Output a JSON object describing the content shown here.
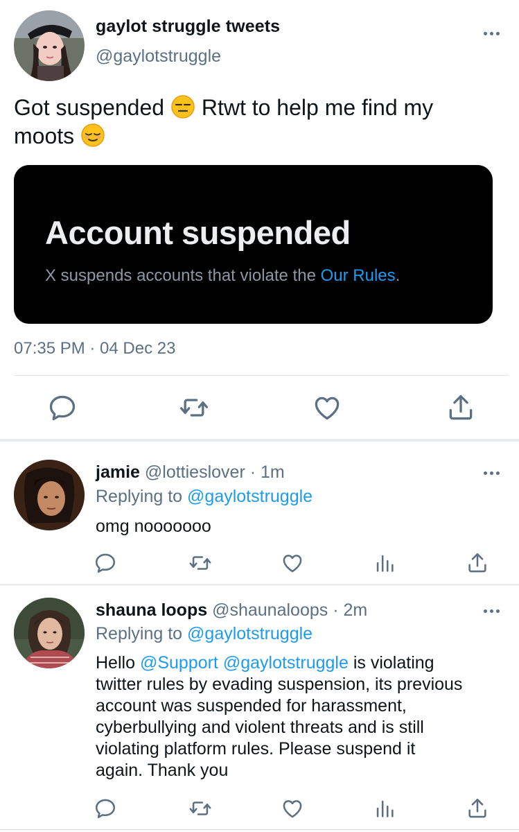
{
  "main_tweet": {
    "display_name": "gaylot struggle tweets",
    "handle": "@gaylotstruggle",
    "text_part1": "Got suspended",
    "text_part2": "Rtwt to help me find my",
    "text_part3": "moots",
    "emoji1": "expressionless-face-emoji",
    "emoji2": "relieved-face-emoji",
    "media": {
      "title": "Account suspended",
      "subtitle_prefix": "X suspends accounts that violate the",
      "subtitle_link": "Our Rules",
      "subtitle_suffix": "."
    },
    "timestamp": "07:35 PM · 04 Dec 23",
    "actions": [
      "reply-icon",
      "retweet-icon",
      "like-icon",
      "share-icon"
    ]
  },
  "replies": [
    {
      "display_name": "jamie",
      "handle": "@lottieslover",
      "time": "· 1m",
      "replying_prefix": "Replying to",
      "replying_to": "@gaylotstruggle",
      "text": "omg nooooooo",
      "actions": [
        "reply-icon",
        "retweet-icon",
        "like-icon",
        "analytics-icon",
        "share-icon"
      ]
    },
    {
      "display_name": "shauna loops",
      "handle": "@shaunaloops",
      "time": "· 2m",
      "replying_prefix": "Replying to",
      "replying_to": "@gaylotstruggle",
      "text_prefix": "Hello",
      "mention1": "@Support",
      "mention2": "@gaylotstruggle",
      "text_rest1": "is violating",
      "text_line2": "twitter rules by evading suspension, its previous",
      "text_line3": "account was suspended for harassment,",
      "text_line4": "cyberbullying and violent threats and is still",
      "text_line5": "violating platform rules. Please suspend it",
      "text_line6": "again. Thank you",
      "actions": [
        "reply-icon",
        "retweet-icon",
        "like-icon",
        "analytics-icon",
        "share-icon"
      ]
    }
  ],
  "colors": {
    "link": "#1d9bf0",
    "muted": "#5b7083",
    "media_bg": "#000000"
  }
}
